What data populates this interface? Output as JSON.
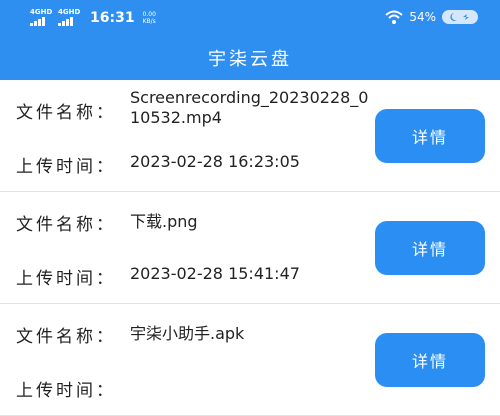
{
  "status_bar": {
    "network1": "4GHD",
    "network2": "4GHD",
    "time": "16:31",
    "speed_value": "0.00",
    "speed_unit": "KB/s",
    "battery": "54%"
  },
  "header": {
    "title": "宇柒云盘"
  },
  "files": [
    {
      "name_label": "文件名称：",
      "name": "Screenrecording_20230228_010532.mp4",
      "time_label": "上传时间：",
      "time": "2023-02-28 16:23:05",
      "button": "详情"
    },
    {
      "name_label": "文件名称：",
      "name": "下载.png",
      "time_label": "上传时间：",
      "time": "2023-02-28 15:41:47",
      "button": "详情"
    },
    {
      "name_label": "文件名称：",
      "name": "宇柒小助手.apk",
      "time_label": "上传时间：",
      "time": "",
      "button": "详情"
    }
  ]
}
